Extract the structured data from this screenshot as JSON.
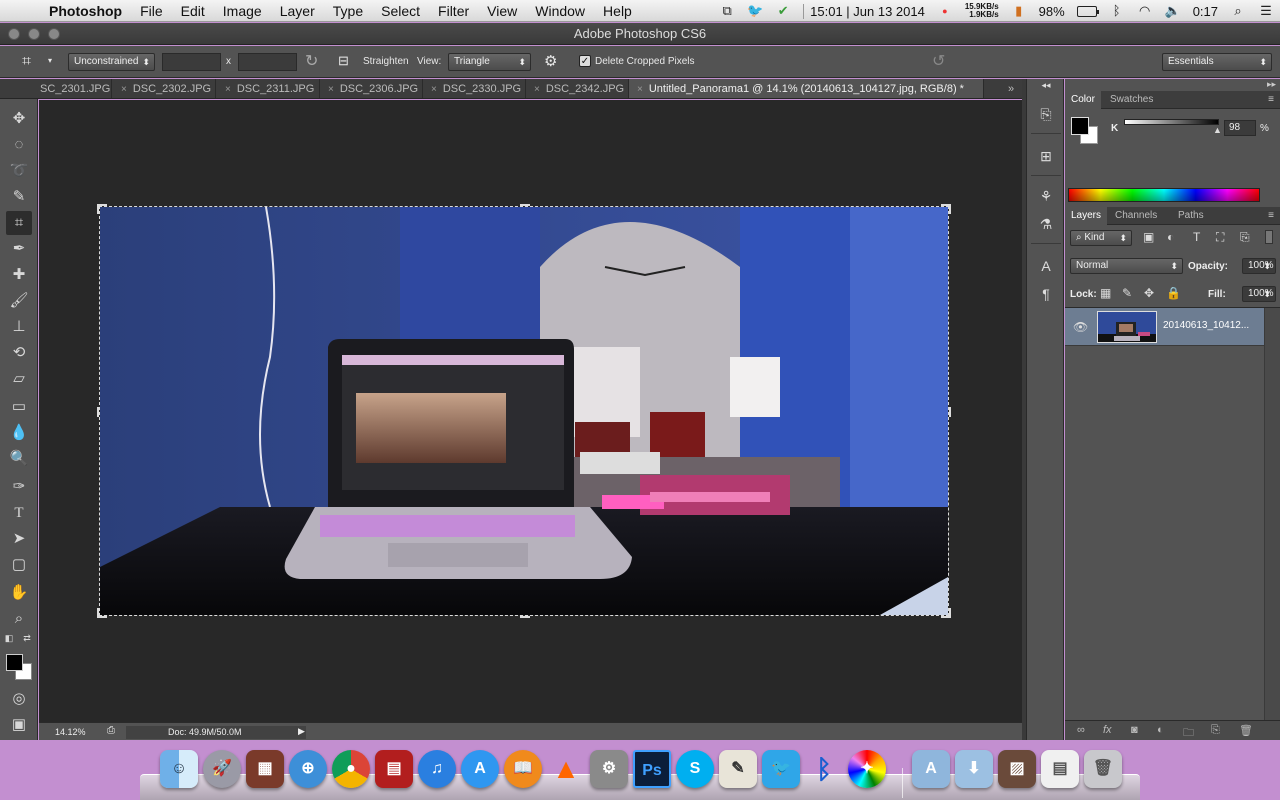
{
  "menubar": {
    "apple": "",
    "items": [
      "Photoshop",
      "File",
      "Edit",
      "Image",
      "Layer",
      "Type",
      "Select",
      "Filter",
      "View",
      "Window",
      "Help"
    ],
    "datetime": "15:01 | Jun 13 2014",
    "net_up": "15.9KB/s",
    "net_down": "1.9KB/s",
    "battery": "98%",
    "clock": "0:17"
  },
  "window": {
    "title": "Adobe Photoshop CS6"
  },
  "options": {
    "ratio": "Unconstrained",
    "x_sep": "x",
    "straighten": "Straighten",
    "view_label": "View:",
    "view_value": "Triangle",
    "delete_cropped": "Delete Cropped Pixels",
    "workspace": "Essentials"
  },
  "tabs": [
    {
      "label": "SC_2301.JPG",
      "close": ""
    },
    {
      "label": "DSC_2302.JPG",
      "close": "×"
    },
    {
      "label": "DSC_2311.JPG",
      "close": "×"
    },
    {
      "label": "DSC_2306.JPG",
      "close": "×"
    },
    {
      "label": "DSC_2330.JPG",
      "close": "×"
    },
    {
      "label": "DSC_2342.JPG",
      "close": "×"
    },
    {
      "label": "Untitled_Panorama1 @ 14.1% (20140613_104127.jpg, RGB/8) *",
      "close": "×"
    }
  ],
  "statusbar": {
    "zoom": "14.12%",
    "doc": "Doc: 49.9M/50.0M"
  },
  "color_panel": {
    "tabs": [
      "Color",
      "Swatches"
    ],
    "channel": "K",
    "value": "98",
    "unit": "%"
  },
  "layers_panel": {
    "tabs": [
      "Layers",
      "Channels",
      "Paths"
    ],
    "filter": "Kind",
    "blend": "Normal",
    "opacity_label": "Opacity:",
    "opacity": "100%",
    "lock_label": "Lock:",
    "fill_label": "Fill:",
    "fill": "100%",
    "layer_name": "20140613_104127.jpg",
    "layer_name_display": "20140613_10412..."
  },
  "dock_apps": [
    "Finder",
    "Launchpad",
    "Photo Booth",
    "Safari",
    "Chrome",
    "Photo Slideshow",
    "iTunes",
    "App Store",
    "iBooks",
    "VLC",
    "System Preferences",
    "Photoshop",
    "Skype",
    "Preview",
    "Twitter",
    "Bluetooth",
    "Colorful",
    "Applications",
    "Downloads",
    "Photos",
    "Spreadsheet",
    "Trash"
  ],
  "colors": {
    "ps_panel": "#535353",
    "canvas_bg": "#282828",
    "accent_selected_layer": "#6d7d92",
    "desktop": "#c38fd0"
  }
}
